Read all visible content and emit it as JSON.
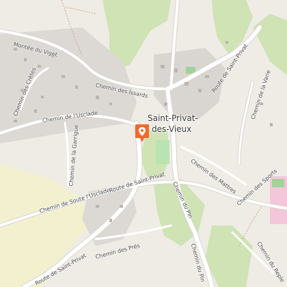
{
  "map": {
    "colors": {
      "land": "#efece6",
      "vegetation": "#cfe3b4",
      "urban": "#d9d6d2",
      "building": "#bdb3ad",
      "road": "#ffffff",
      "path": "#c9a07e",
      "sport": "#f3c6d9",
      "pitch": "#9ed39a",
      "park": "#b9e3b0",
      "marker": "#ef6a2f"
    },
    "town_label_line1": "Saint-Privat-",
    "town_label_line2": "des-Vieux",
    "street_labels": {
      "montee_viget": "Montée du Viget",
      "chemin_cretes": "Chemin des Crêtes",
      "chemin_issards": "Chemin des Issards",
      "chemin_usclade": "Chemin de l'Usclade",
      "chemin_garrigue": "Chemin de la Garrigue",
      "chemin_soute": "Chemin de Soute l'Usclade",
      "route_sp_west": "Route de Saint-Privat",
      "route_sp_north": "Route de Saint-Privat",
      "route_sp_south": "Route de Saint-Privat",
      "chemin_pres": "Chemin des Prés",
      "chemin_mattres": "Chemin des Mattres",
      "chemin_sports": "Chemin des Sports",
      "chemin_varie": "Chemin de la Varie",
      "chemin_pin_north": "Chemin du Pin",
      "chemin_pin_south": "Chemin du Pin",
      "chemin_reple": "Chemin du Reple"
    },
    "marker_icon": "map-pin-icon"
  }
}
